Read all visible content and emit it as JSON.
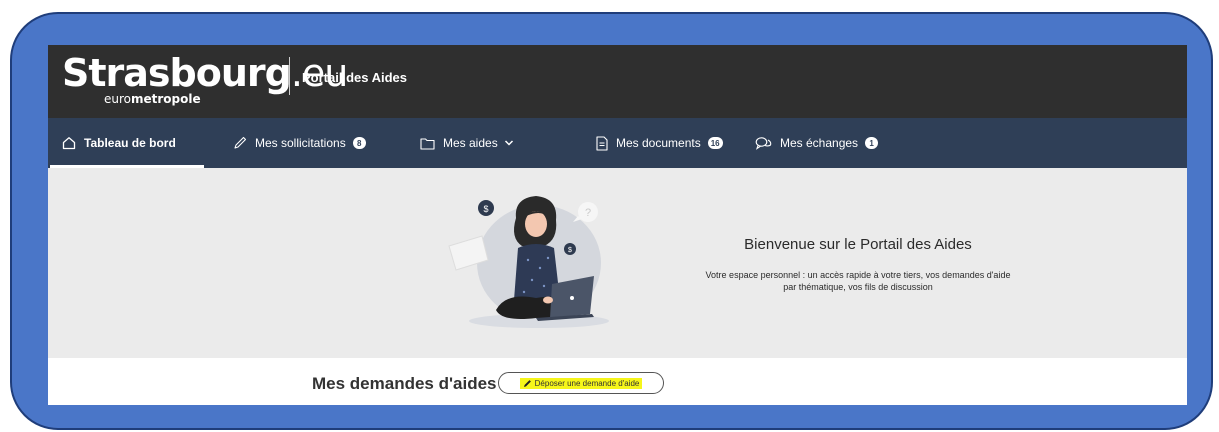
{
  "header": {
    "logo_main": "Strasbourg",
    "logo_ext": ".eu",
    "logo_sub_prefix": "euro",
    "logo_sub_bold": "metropole",
    "portal_title": "Portail des Aides"
  },
  "nav": {
    "items": [
      {
        "label": "Tableau de bord",
        "icon": "home-icon",
        "active": true
      },
      {
        "label": "Mes sollicitations",
        "icon": "pen-icon",
        "badge": "8"
      },
      {
        "label": "Mes aides",
        "icon": "folder-icon",
        "dropdown": true
      },
      {
        "label": "Mes documents",
        "icon": "document-icon",
        "badge": "16"
      },
      {
        "label": "Mes échanges",
        "icon": "chat-icon",
        "badge": "1"
      }
    ]
  },
  "welcome": {
    "title": "Bienvenue sur le Portail des Aides",
    "text_line1": "Votre espace personnel : un accès rapide à votre tiers, vos demandes d'aide",
    "text_line2": "par thématique, vos fils de discussion"
  },
  "demandes": {
    "title": "Mes demandes d'aides",
    "deposit_label": "Déposer une demande d'aide",
    "highlight_color": "#f6f61a"
  },
  "colors": {
    "frame": "#4a76c8",
    "topbar": "#2f2f2f",
    "navbar": "#2f3f57",
    "background": "#ebebeb"
  }
}
